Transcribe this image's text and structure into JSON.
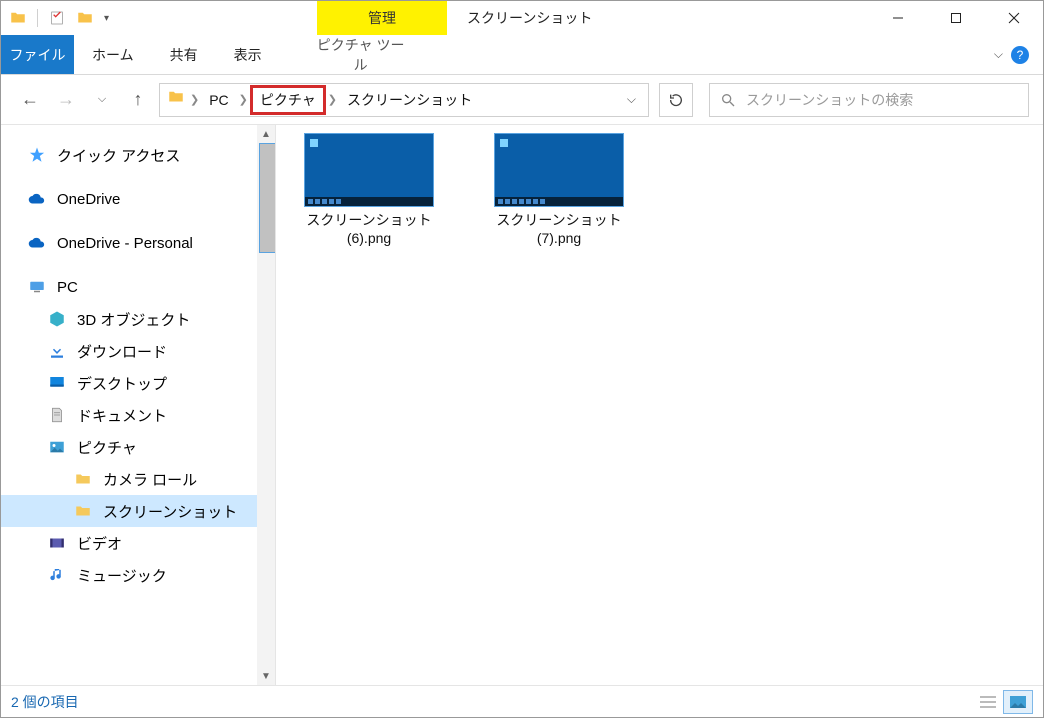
{
  "titlebar": {
    "context_label": "管理",
    "title": "スクリーンショット"
  },
  "ribbon": {
    "file": "ファイル",
    "home": "ホーム",
    "share": "共有",
    "view": "表示",
    "context_tool": "ピクチャ ツール"
  },
  "breadcrumb": {
    "items": [
      "PC",
      "ピクチャ",
      "スクリーンショット"
    ],
    "highlighted_index": 1
  },
  "search": {
    "placeholder": "スクリーンショットの検索"
  },
  "sidebar": {
    "quick_access": "クイック アクセス",
    "onedrive": "OneDrive",
    "onedrive_personal": "OneDrive - Personal",
    "pc": "PC",
    "pc_children": [
      "3D オブジェクト",
      "ダウンロード",
      "デスクトップ",
      "ドキュメント",
      "ピクチャ"
    ],
    "pictures_children": [
      "カメラ ロール",
      "スクリーンショット"
    ],
    "video": "ビデオ",
    "music": "ミュージック"
  },
  "files": [
    {
      "name_l1": "スクリーンショット",
      "name_l2": "(6).png"
    },
    {
      "name_l1": "スクリーンショット",
      "name_l2": "(7).png"
    }
  ],
  "status": {
    "count_text": "2 個の項目"
  }
}
